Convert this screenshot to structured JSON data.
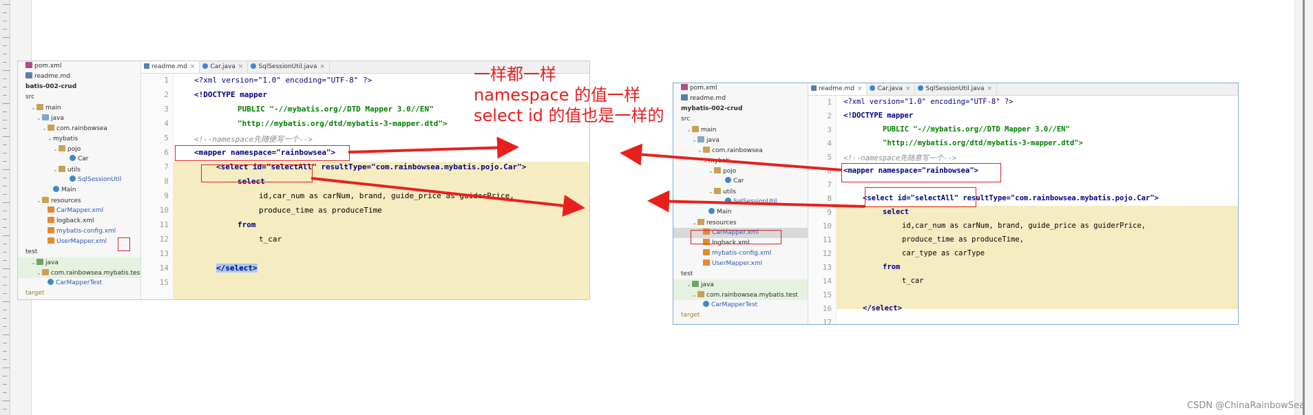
{
  "left_panel": {
    "tabs": [
      {
        "label": "readme.md",
        "icon": "markdown-file-icon"
      },
      {
        "label": "Car.java",
        "icon": "java-class-icon"
      },
      {
        "label": "SqlSessionUtil.java",
        "icon": "java-class-icon"
      }
    ],
    "tree": [
      {
        "label": "pom.xml",
        "icon": "pom-icon",
        "style": ""
      },
      {
        "label": "readme.md",
        "icon": "md-icon",
        "style": ""
      },
      {
        "label": "batis-002-crud",
        "icon": "",
        "style": "bold"
      },
      {
        "label": "src",
        "icon": "",
        "style": ""
      },
      {
        "label": "main",
        "icon": "folder-icon",
        "style": ""
      },
      {
        "label": "java",
        "icon": "src-folder-icon",
        "style": ""
      },
      {
        "label": "com.rainbowsea",
        "icon": "folder-icon",
        "style": ""
      },
      {
        "label": "mybatis",
        "icon": "",
        "style": ""
      },
      {
        "label": "pojo",
        "icon": "folder-icon",
        "style": ""
      },
      {
        "label": "Car",
        "icon": "class-icon",
        "style": ""
      },
      {
        "label": "utils",
        "icon": "folder-icon",
        "style": ""
      },
      {
        "label": "SqlSessionUtil",
        "icon": "class-icon",
        "style": "blue"
      },
      {
        "label": "Main",
        "icon": "class-icon",
        "style": ""
      },
      {
        "label": "resources",
        "icon": "folder-icon",
        "style": ""
      },
      {
        "label": "CarMapper.xml",
        "icon": "xml-icon",
        "style": "blue"
      },
      {
        "label": "logback.xml",
        "icon": "xml-icon",
        "style": ""
      },
      {
        "label": "mybatis-config.xml",
        "icon": "xml-icon",
        "style": "blue"
      },
      {
        "label": "UserMapper.xml",
        "icon": "xml-icon",
        "style": "blue"
      },
      {
        "label": "test",
        "icon": "",
        "style": ""
      },
      {
        "label": "java",
        "icon": "test-folder-icon",
        "style": "green"
      },
      {
        "label": "com.rainbowsea.mybatis.test",
        "icon": "folder-icon",
        "style": "green"
      },
      {
        "label": "CarMapperTest",
        "icon": "class-icon",
        "style": "blue"
      },
      {
        "label": "target",
        "icon": "",
        "style": "gray"
      }
    ],
    "line_numbers": [
      "1",
      "2",
      "3",
      "4",
      "5",
      "6",
      "7",
      "8",
      "9",
      "10",
      "11",
      "12",
      "13",
      "14",
      "15"
    ]
  },
  "right_panel": {
    "tabs": [
      {
        "label": "readme.md",
        "icon": "markdown-file-icon"
      },
      {
        "label": "Car.java",
        "icon": "java-class-icon"
      },
      {
        "label": "SqlSessionUtil.java",
        "icon": "java-class-icon"
      }
    ],
    "tree": [
      {
        "label": "pom.xml",
        "icon": "pom-icon",
        "style": ""
      },
      {
        "label": "readme.md",
        "icon": "md-icon",
        "style": ""
      },
      {
        "label": "mybatis-002-crud",
        "icon": "",
        "style": "bold"
      },
      {
        "label": "src",
        "icon": "",
        "style": ""
      },
      {
        "label": "main",
        "icon": "folder-icon",
        "style": ""
      },
      {
        "label": "java",
        "icon": "src-folder-icon",
        "style": ""
      },
      {
        "label": "com.rainbowsea",
        "icon": "folder-icon",
        "style": ""
      },
      {
        "label": "mybati",
        "icon": "",
        "style": ""
      },
      {
        "label": "pojo",
        "icon": "folder-icon",
        "style": ""
      },
      {
        "label": "Car",
        "icon": "class-icon",
        "style": ""
      },
      {
        "label": "utils",
        "icon": "folder-icon",
        "style": ""
      },
      {
        "label": "SqlSessionUtil",
        "icon": "class-icon",
        "style": "blue"
      },
      {
        "label": "Main",
        "icon": "class-icon",
        "style": ""
      },
      {
        "label": "resources",
        "icon": "folder-icon",
        "style": ""
      },
      {
        "label": "CarMapper.xml",
        "icon": "xml-icon",
        "style": "selected"
      },
      {
        "label": "logback.xml",
        "icon": "xml-icon",
        "style": ""
      },
      {
        "label": "mybatis-config.xml",
        "icon": "xml-icon",
        "style": "blue"
      },
      {
        "label": "UserMapper.xml",
        "icon": "xml-icon",
        "style": "blue"
      },
      {
        "label": "test",
        "icon": "",
        "style": ""
      },
      {
        "label": "java",
        "icon": "test-folder-icon",
        "style": "green"
      },
      {
        "label": "com.rainbowsea.mybatis.test",
        "icon": "folder-icon",
        "style": "green"
      },
      {
        "label": "CarMapperTest",
        "icon": "class-icon",
        "style": "blue"
      },
      {
        "label": "target",
        "icon": "",
        "style": "gray"
      }
    ],
    "line_numbers": [
      "1",
      "2",
      "3",
      "4",
      "5",
      "6",
      "7",
      "8",
      "9",
      "10",
      "11",
      "12",
      "13",
      "14",
      "15",
      "16",
      "17"
    ]
  },
  "code": {
    "xml_decl": "<?xml version=\"1.0\" encoding=\"UTF-8\" ?>",
    "doctype": "<!DOCTYPE mapper",
    "public_id": "PUBLIC \"-//mybatis.org//DTD Mapper 3.0//EN\"",
    "dtd_url": "\"http://mybatis.org/dtd/mybatis-3-mapper.dtd\">",
    "comment_left": "<!--namespace先随便写一个-->",
    "comment_right": "<!--namespace先随意写一个-->",
    "mapper_open": "<mapper namespace=\"rainbowsea\">",
    "select_open": "<select id=\"selectAll\" resultType=\"com.rainbowsea.mybatis.pojo.Car\">",
    "select_kw": "select",
    "columns": "id,car_num as carNum, brand, guide_price as guiderPrice,",
    "produce_left": "produce_time as produceTime",
    "produce_right": "produce_time as produceTime,",
    "car_type": "car_type as carType",
    "from_kw": "from",
    "table": "t_car",
    "select_close": "</select>"
  },
  "annotation": {
    "line1": "一样都一样",
    "line2": "namespace 的值一样",
    "line3": "select id 的值也是一样的",
    "color": "#e81d1d"
  },
  "watermark": "CSDN @ChinaRainbowSea"
}
